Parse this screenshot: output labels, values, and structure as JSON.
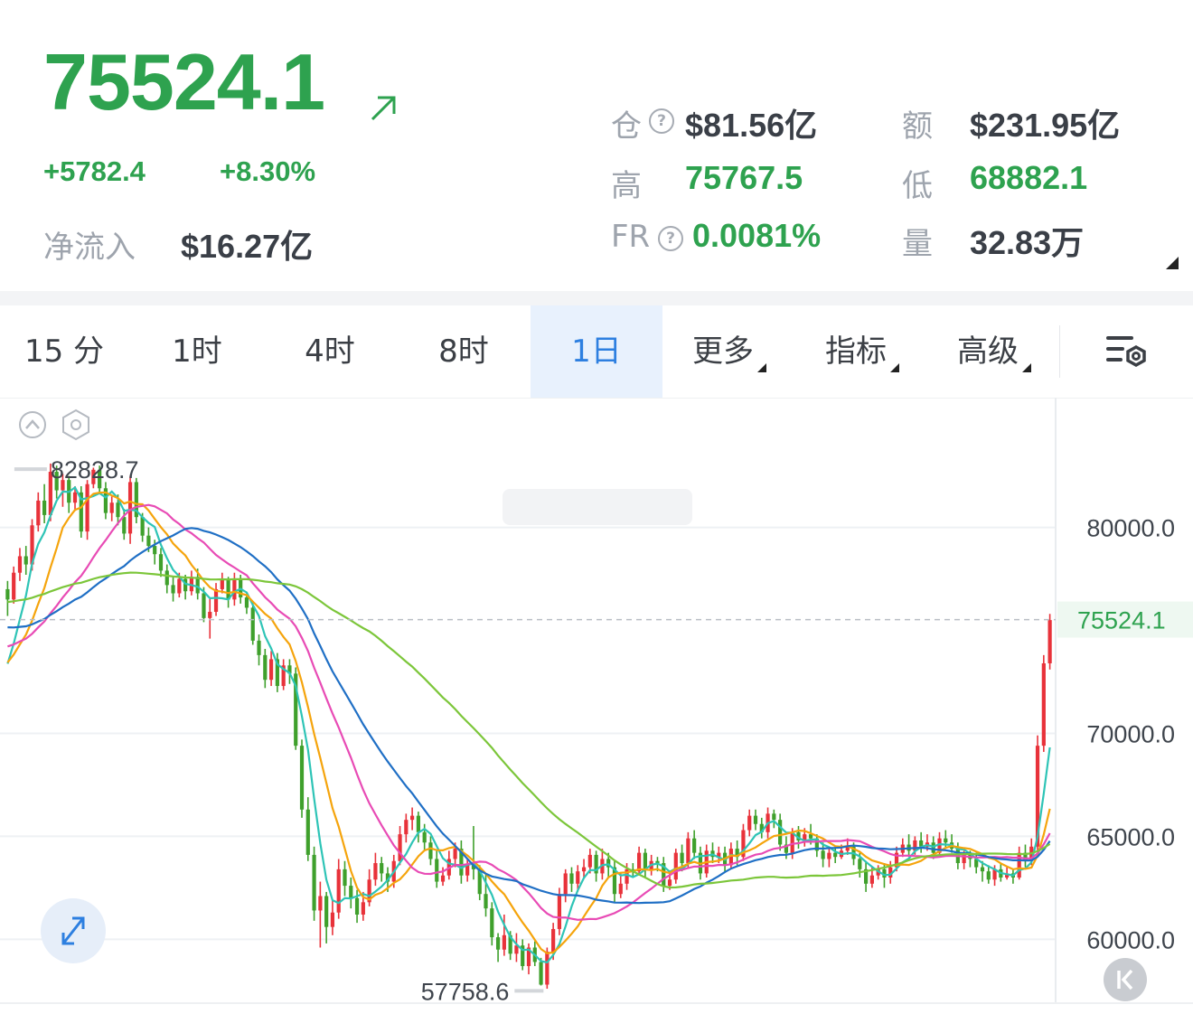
{
  "ticker": {
    "price": "75524.1",
    "change": "+5782.4",
    "change_pct": "+8.30%",
    "netflow_label": "净流入",
    "netflow_value": "$16.27亿"
  },
  "stats": {
    "oi_label": "仓",
    "oi_value": "$81.56亿",
    "turnover_label": "额",
    "turnover_value": "$231.95亿",
    "high_label": "高",
    "high_value": "75767.5",
    "low_label": "低",
    "low_value": "68882.1",
    "fr_label": "FR",
    "fr_value": "0.0081%",
    "volume_label": "量",
    "volume_value": "32.83万",
    "help_glyph": "?"
  },
  "tabs": [
    {
      "label": "15 分",
      "active": false
    },
    {
      "label": "1时",
      "active": false
    },
    {
      "label": "4时",
      "active": false
    },
    {
      "label": "8时",
      "active": false
    },
    {
      "label": "1日",
      "active": true
    },
    {
      "label": "更多",
      "active": false,
      "dropdown": true
    },
    {
      "label": "指标",
      "active": false,
      "dropdown": true
    },
    {
      "label": "高级",
      "active": false,
      "dropdown": true
    }
  ],
  "icons": {
    "arrow": "arrow-up-right-icon",
    "settings": "chart-settings-icon",
    "collapse": "collapse-up-icon",
    "hexagon": "hexagon-settings-icon",
    "expand": "expand-icon",
    "jump": "jump-to-latest-icon"
  },
  "colors": {
    "up": "#e8323a",
    "down": "#3fa02c",
    "price_green": "#2ea24f",
    "ma_cyan": "#2ec4b6",
    "ma_orange": "#f5a40c",
    "ma_magenta": "#e84bb5",
    "ma_blue": "#1f6fc5",
    "ma_lime": "#7cc63a"
  },
  "chart_data": {
    "type": "candlestick",
    "y_ticks": [
      "80000.0",
      "70000.0",
      "65000.0",
      "60000.0"
    ],
    "ylim": [
      56900,
      86300
    ],
    "last_price": "75524.1",
    "max_label": "82828.7",
    "min_label": "57758.6",
    "candles": [
      [
        77000,
        76500,
        77400,
        75700
      ],
      [
        76500,
        77800,
        78100,
        76300
      ],
      [
        77800,
        78600,
        79000,
        77400
      ],
      [
        78600,
        78200,
        79100,
        77700
      ],
      [
        78200,
        80100,
        80400,
        77900
      ],
      [
        80100,
        81300,
        81700,
        79800
      ],
      [
        81300,
        80600,
        82100,
        80200
      ],
      [
        80600,
        82700,
        83100,
        80300
      ],
      [
        82700,
        81800,
        83000,
        81400
      ],
      [
        81800,
        82300,
        82600,
        81000
      ],
      [
        82300,
        81200,
        82500,
        80700
      ],
      [
        81200,
        81700,
        82000,
        80800
      ],
      [
        81700,
        79800,
        82000,
        79500
      ],
      [
        79800,
        82100,
        82300,
        79400
      ],
      [
        82100,
        82800,
        82900,
        81900
      ],
      [
        82800,
        81900,
        83000,
        81700
      ],
      [
        81900,
        80700,
        82200,
        80400
      ],
      [
        80700,
        81200,
        81500,
        80300
      ],
      [
        81200,
        80500,
        81600,
        80100
      ],
      [
        80500,
        79700,
        80900,
        79400
      ],
      [
        79700,
        82200,
        82500,
        79200
      ],
      [
        82200,
        80500,
        82400,
        80200
      ],
      [
        80500,
        79600,
        80700,
        79300
      ],
      [
        79600,
        79100,
        80000,
        78800
      ],
      [
        79100,
        78700,
        79400,
        78200
      ],
      [
        78700,
        77900,
        79000,
        77600
      ],
      [
        77900,
        77200,
        78200,
        76800
      ],
      [
        77200,
        76800,
        77600,
        76400
      ],
      [
        76800,
        77500,
        77800,
        76600
      ],
      [
        77500,
        76900,
        77700,
        76500
      ],
      [
        76900,
        77600,
        77900,
        76700
      ],
      [
        77600,
        76800,
        78000,
        76500
      ],
      [
        76800,
        75600,
        77100,
        75400
      ],
      [
        75600,
        75900,
        76600,
        74600
      ],
      [
        75900,
        77000,
        77300,
        75700
      ],
      [
        77000,
        77500,
        77800,
        76800
      ],
      [
        77500,
        76500,
        77600,
        76100
      ],
      [
        76500,
        77500,
        77800,
        76200
      ],
      [
        77500,
        76600,
        77700,
        76300
      ],
      [
        76600,
        76100,
        76800,
        75800
      ],
      [
        76100,
        74500,
        76400,
        74300
      ],
      [
        74500,
        73800,
        74800,
        73300
      ],
      [
        73800,
        72600,
        74100,
        72200
      ],
      [
        72600,
        73600,
        74000,
        72300
      ],
      [
        73600,
        72300,
        73900,
        72000
      ],
      [
        72300,
        73300,
        73600,
        72100
      ],
      [
        73300,
        72900,
        73600,
        72400
      ],
      [
        72900,
        69400,
        73200,
        69200
      ],
      [
        69400,
        66300,
        69700,
        65900
      ],
      [
        66300,
        64100,
        66900,
        63800
      ],
      [
        64100,
        61400,
        64500,
        60900
      ],
      [
        61400,
        62100,
        62800,
        59600
      ],
      [
        62100,
        60600,
        62300,
        59800
      ],
      [
        60600,
        61300,
        61900,
        60200
      ],
      [
        61300,
        63400,
        63900,
        61000
      ],
      [
        63400,
        62600,
        63800,
        62100
      ],
      [
        62600,
        62000,
        63000,
        61500
      ],
      [
        62000,
        61200,
        62400,
        60800
      ],
      [
        61200,
        61800,
        62300,
        60900
      ],
      [
        61800,
        62900,
        63400,
        61600
      ],
      [
        62900,
        63700,
        64200,
        62600
      ],
      [
        63700,
        63200,
        64000,
        62800
      ],
      [
        63200,
        62800,
        63500,
        62300
      ],
      [
        62800,
        63800,
        64100,
        62500
      ],
      [
        63800,
        65100,
        65500,
        63600
      ],
      [
        65100,
        65800,
        66100,
        64700
      ],
      [
        65800,
        66000,
        66400,
        65300
      ],
      [
        66000,
        65200,
        66200,
        64700
      ],
      [
        65200,
        64700,
        65600,
        64300
      ],
      [
        64700,
        63900,
        65000,
        63600
      ],
      [
        63900,
        62800,
        64300,
        62500
      ],
      [
        62800,
        63100,
        63500,
        62600
      ],
      [
        63100,
        63900,
        64300,
        62900
      ],
      [
        63900,
        64400,
        64700,
        63500
      ],
      [
        64400,
        63100,
        64800,
        62700
      ],
      [
        63100,
        63600,
        63900,
        62800
      ],
      [
        63600,
        63400,
        65500,
        62900
      ],
      [
        63400,
        62200,
        63600,
        61900
      ],
      [
        62200,
        61500,
        63200,
        61100
      ],
      [
        61500,
        60100,
        61800,
        59700
      ],
      [
        60100,
        59500,
        60300,
        58900
      ],
      [
        59500,
        60200,
        61200,
        59200
      ],
      [
        60200,
        59300,
        60400,
        59000
      ],
      [
        59300,
        59700,
        60300,
        58900
      ],
      [
        59700,
        58700,
        60000,
        58500
      ],
      [
        58700,
        59600,
        59800,
        58300
      ],
      [
        59600,
        58900,
        59900,
        58700
      ],
      [
        58900,
        57800,
        59100,
        57758
      ],
      [
        57800,
        59400,
        59600,
        57600
      ],
      [
        59400,
        60500,
        60800,
        59000
      ],
      [
        60500,
        62200,
        62500,
        60200
      ],
      [
        62200,
        63200,
        63400,
        61800
      ],
      [
        63200,
        62700,
        63500,
        62300
      ],
      [
        62700,
        63300,
        63600,
        62300
      ],
      [
        63300,
        63500,
        63900,
        63000
      ],
      [
        63500,
        64100,
        64400,
        63200
      ],
      [
        64100,
        63200,
        64300,
        62800
      ],
      [
        63200,
        63900,
        64400,
        62900
      ],
      [
        63900,
        63500,
        64200,
        63000
      ],
      [
        63500,
        62200,
        63800,
        61800
      ],
      [
        62200,
        62700,
        63200,
        62000
      ],
      [
        62700,
        63400,
        63700,
        62400
      ],
      [
        63400,
        63300,
        63700,
        63000
      ],
      [
        63300,
        64200,
        64500,
        63100
      ],
      [
        64200,
        63400,
        64400,
        63000
      ],
      [
        63400,
        63800,
        64100,
        63100
      ],
      [
        63800,
        63700,
        64000,
        63300
      ],
      [
        63700,
        62600,
        64000,
        62300
      ],
      [
        62600,
        62900,
        63300,
        62400
      ],
      [
        62900,
        64200,
        64400,
        62700
      ],
      [
        64200,
        63700,
        64600,
        63300
      ],
      [
        63700,
        64900,
        65200,
        63500
      ],
      [
        64900,
        64200,
        65300,
        63900
      ],
      [
        64200,
        63200,
        64500,
        62900
      ],
      [
        63200,
        64300,
        64600,
        63000
      ],
      [
        64300,
        64000,
        64700,
        63700
      ],
      [
        64000,
        64200,
        64500,
        63700
      ],
      [
        64200,
        63600,
        64500,
        63300
      ],
      [
        63600,
        64400,
        64700,
        63400
      ],
      [
        64400,
        64000,
        64800,
        63600
      ],
      [
        64000,
        65300,
        65600,
        63800
      ],
      [
        65300,
        66000,
        66300,
        65000
      ],
      [
        66000,
        65600,
        66300,
        65300
      ],
      [
        65600,
        65200,
        65900,
        64900
      ],
      [
        65200,
        66100,
        66400,
        64900
      ],
      [
        66100,
        65800,
        66300,
        65400
      ],
      [
        65800,
        64600,
        66100,
        64300
      ],
      [
        64600,
        64200,
        65000,
        63900
      ],
      [
        64200,
        65200,
        65400,
        63900
      ],
      [
        65200,
        64800,
        65500,
        64400
      ],
      [
        64800,
        65100,
        65400,
        64500
      ],
      [
        65100,
        64900,
        65600,
        64600
      ],
      [
        64900,
        64300,
        65100,
        64000
      ],
      [
        64300,
        63900,
        64700,
        63500
      ],
      [
        63900,
        64200,
        64400,
        63500
      ],
      [
        64200,
        64000,
        64500,
        63700
      ],
      [
        64000,
        64300,
        64600,
        63900
      ],
      [
        64300,
        64500,
        64900,
        64100
      ],
      [
        64500,
        63900,
        64700,
        63600
      ],
      [
        63900,
        63400,
        64200,
        63000
      ],
      [
        63400,
        62700,
        63800,
        62300
      ],
      [
        62700,
        63100,
        63500,
        62500
      ],
      [
        63100,
        63400,
        63600,
        62900
      ],
      [
        63400,
        63000,
        63700,
        62500
      ],
      [
        63000,
        63500,
        63800,
        62700
      ],
      [
        63500,
        64200,
        64500,
        63300
      ],
      [
        64200,
        64600,
        64900,
        64000
      ],
      [
        64600,
        64300,
        65100,
        64000
      ],
      [
        64300,
        64800,
        65000,
        64100
      ],
      [
        64800,
        64500,
        65200,
        64200
      ],
      [
        64500,
        64700,
        65100,
        64300
      ],
      [
        64700,
        64200,
        65000,
        63900
      ],
      [
        64200,
        64900,
        65200,
        64000
      ],
      [
        64900,
        64700,
        65300,
        64400
      ],
      [
        64700,
        64400,
        65100,
        64200
      ],
      [
        64400,
        63700,
        64700,
        63400
      ],
      [
        63700,
        64100,
        64300,
        63400
      ],
      [
        64100,
        63900,
        64300,
        63500
      ],
      [
        63900,
        63500,
        64200,
        63200
      ],
      [
        63500,
        63300,
        63800,
        62800
      ],
      [
        63300,
        62900,
        63600,
        62700
      ],
      [
        62900,
        63400,
        63600,
        62600
      ],
      [
        63400,
        63000,
        63700,
        62800
      ],
      [
        63000,
        63200,
        63500,
        62900
      ],
      [
        63200,
        63000,
        63400,
        62700
      ],
      [
        63000,
        64200,
        64500,
        62900
      ],
      [
        64200,
        63800,
        64600,
        63500
      ],
      [
        63800,
        64500,
        64900,
        63600
      ],
      [
        64500,
        69400,
        69900,
        64300
      ],
      [
        69400,
        73400,
        73800,
        69100
      ],
      [
        73400,
        75500,
        75800,
        73100
      ]
    ]
  }
}
